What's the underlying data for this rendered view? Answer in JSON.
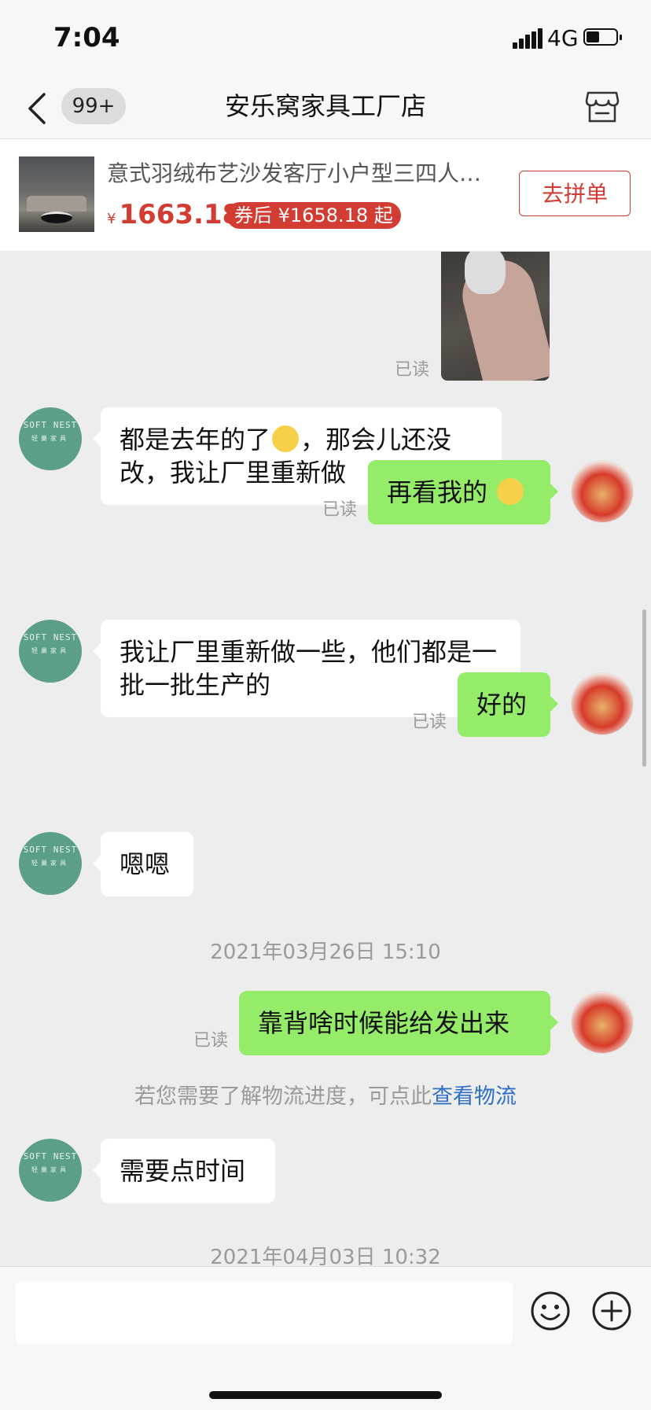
{
  "status": {
    "time": "7:04",
    "network": "4G"
  },
  "nav": {
    "badge": "99+",
    "title": "安乐窝家具工厂店"
  },
  "product": {
    "title": "意式羽绒布艺沙发客厅小户型三四人位直排组合现代简约北欧乳胶沙发",
    "currency": "¥",
    "price": "1663.18",
    "coupon": "券后 ¥1658.18 起",
    "button": "去拼单"
  },
  "messages": [
    {
      "side": "out",
      "type": "image",
      "read": "已读"
    },
    {
      "side": "in",
      "text_a": "都是去年的了",
      "text_b": "，那会儿还没改，我让厂里重新做"
    },
    {
      "side": "out",
      "text": "再看我的",
      "read": "已读"
    },
    {
      "side": "in",
      "text": "我让厂里重新做一些，他们都是一批一批生产的"
    },
    {
      "side": "out",
      "text": "好的",
      "read": "已读"
    },
    {
      "side": "in",
      "text": "嗯嗯"
    },
    {
      "type": "timestamp",
      "text": "2021年03月26日 15:10"
    },
    {
      "side": "out",
      "text": "靠背啥时候能给发出来",
      "read": "已读"
    },
    {
      "type": "notice",
      "text": "若您需要了解物流进度，可点此",
      "link": "查看物流"
    },
    {
      "side": "in",
      "text": "需要点时间"
    },
    {
      "type": "timestamp",
      "text": "2021年04月03日 10:32"
    }
  ],
  "shop_avatar": {
    "line1": "SOFT NEST",
    "line2": "轻巢家具"
  },
  "input": {
    "placeholder": ""
  },
  "colors": {
    "accent": "#d33c32",
    "bubble_out": "#95ec69",
    "link": "#2f6fc7",
    "shop_avatar": "#5b9f8b"
  },
  "icons": [
    "back-icon",
    "store-icon",
    "emoji-icon",
    "plus-icon"
  ]
}
